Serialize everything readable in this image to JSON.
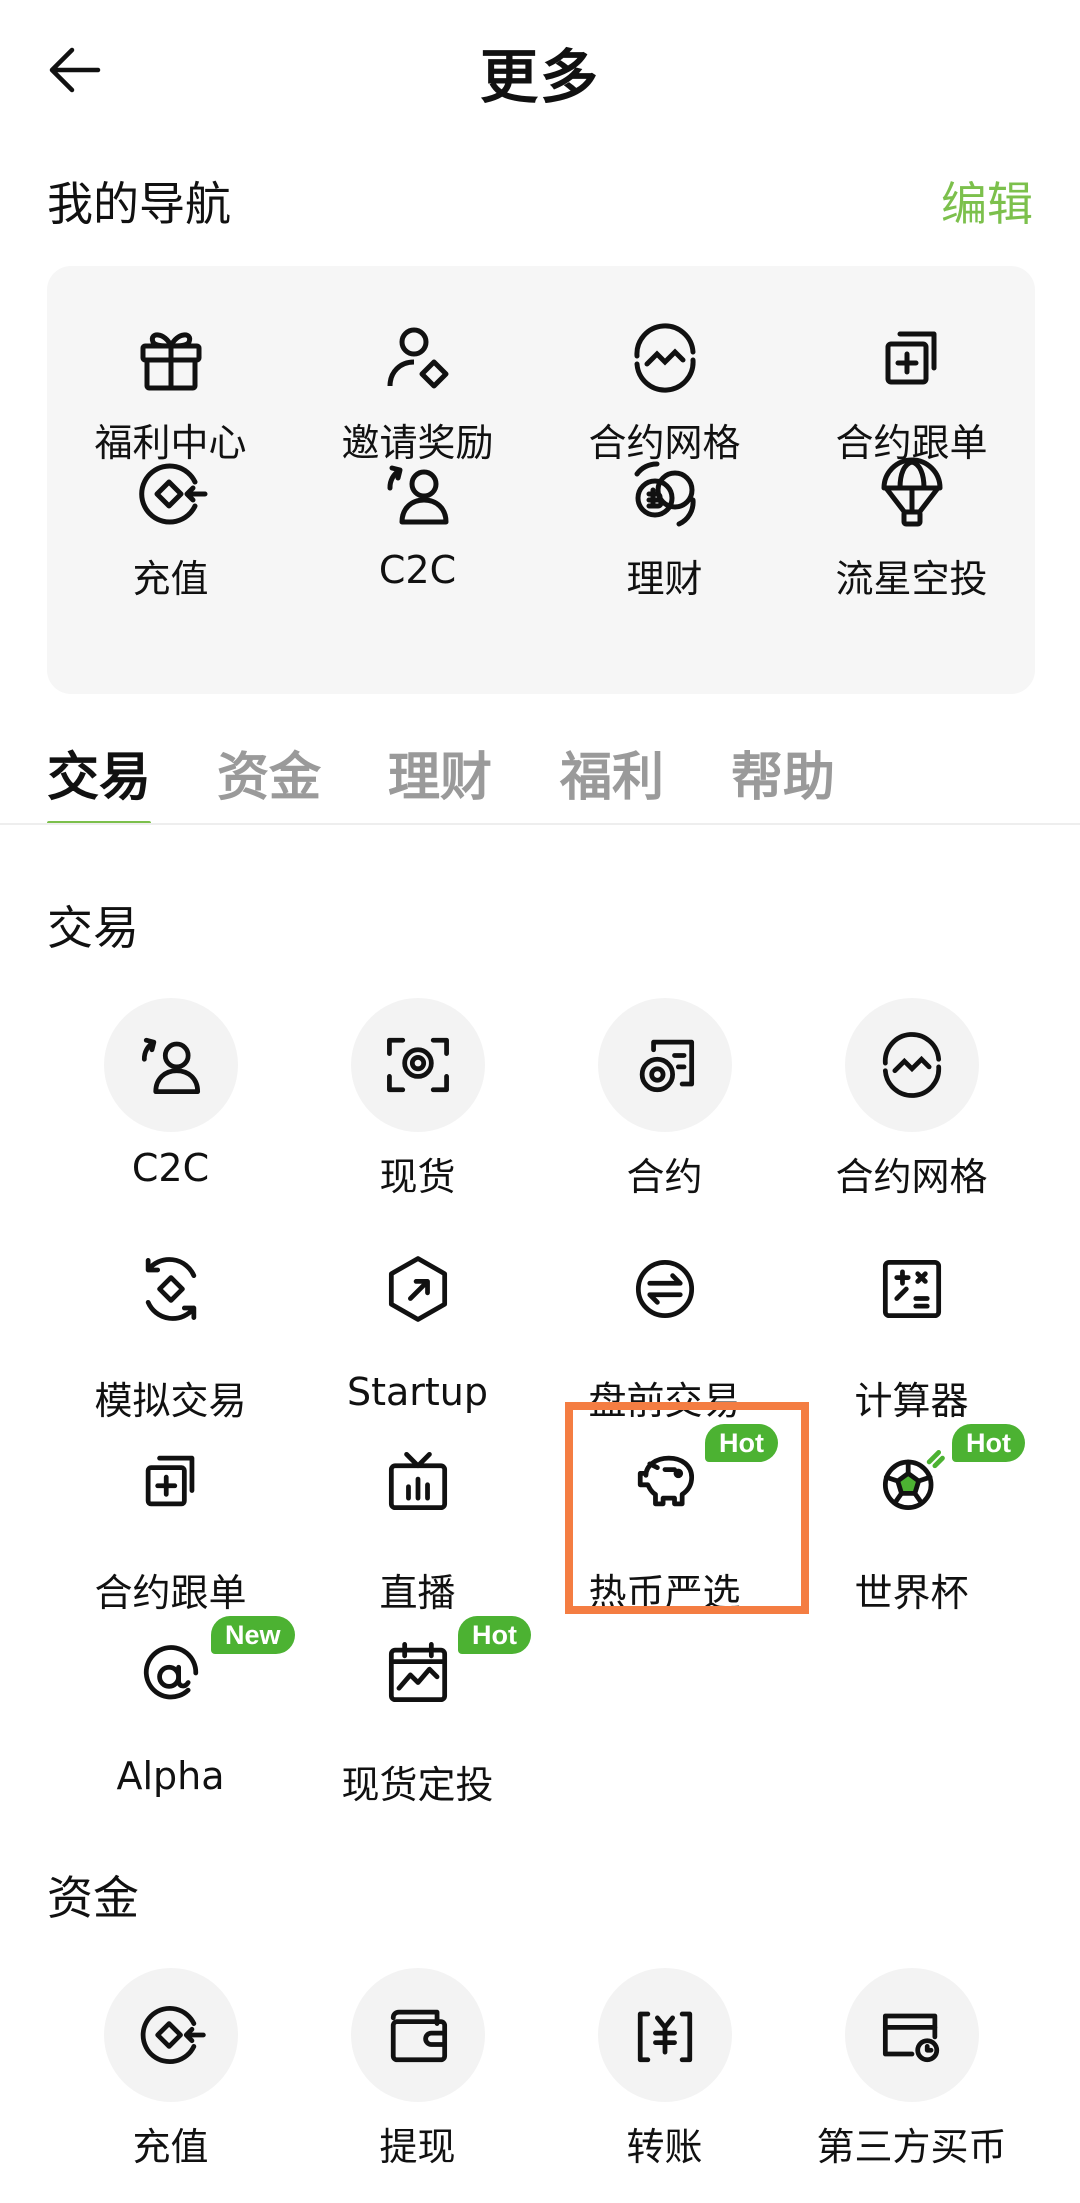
{
  "header": {
    "title": "更多"
  },
  "my_nav": {
    "title": "我的导航",
    "edit_label": "编辑",
    "items": [
      {
        "label": "福利中心",
        "icon": "gift-icon"
      },
      {
        "label": "邀请奖励",
        "icon": "invite-icon"
      },
      {
        "label": "合约网格",
        "icon": "grid-trading-icon"
      },
      {
        "label": "合约跟单",
        "icon": "copy-trade-icon"
      },
      {
        "label": "充值",
        "icon": "deposit-icon"
      },
      {
        "label": "C2C",
        "icon": "c2c-icon"
      },
      {
        "label": "理财",
        "icon": "earn-icon"
      },
      {
        "label": "流星空投",
        "icon": "airdrop-icon"
      }
    ]
  },
  "tabs": [
    "交易",
    "资金",
    "理财",
    "福利",
    "帮助"
  ],
  "trade_section": {
    "title": "交易",
    "items": [
      {
        "label": "C2C",
        "icon": "c2c-icon",
        "badge": ""
      },
      {
        "label": "现货",
        "icon": "spot-icon",
        "badge": ""
      },
      {
        "label": "合约",
        "icon": "futures-icon",
        "badge": ""
      },
      {
        "label": "合约网格",
        "icon": "grid-trading-icon",
        "badge": ""
      },
      {
        "label": "模拟交易",
        "icon": "demo-trading-icon",
        "badge": ""
      },
      {
        "label": "Startup",
        "icon": "startup-icon",
        "badge": ""
      },
      {
        "label": "盘前交易",
        "icon": "pre-market-icon",
        "badge": ""
      },
      {
        "label": "计算器",
        "icon": "calculator-icon",
        "badge": ""
      },
      {
        "label": "合约跟单",
        "icon": "copy-trade-icon",
        "badge": ""
      },
      {
        "label": "直播",
        "icon": "live-tv-icon",
        "badge": ""
      },
      {
        "label": "热币严选",
        "icon": "piggy-bank-icon",
        "badge": "Hot"
      },
      {
        "label": "世界杯",
        "icon": "soccer-ball-icon",
        "badge": "Hot"
      },
      {
        "label": "Alpha",
        "icon": "alpha-icon",
        "badge": "New"
      },
      {
        "label": "现货定投",
        "icon": "calendar-chart-icon",
        "badge": "Hot"
      }
    ]
  },
  "funds_section": {
    "title": "资金",
    "items": [
      {
        "label": "充值",
        "icon": "deposit-icon"
      },
      {
        "label": "提现",
        "icon": "wallet-icon"
      },
      {
        "label": "转账",
        "icon": "transfer-icon"
      },
      {
        "label": "第三方买币",
        "icon": "card-icon"
      }
    ]
  },
  "colors": {
    "accent": "#7cc04c",
    "badge": "#4cb232",
    "highlight": "#f47d42"
  }
}
